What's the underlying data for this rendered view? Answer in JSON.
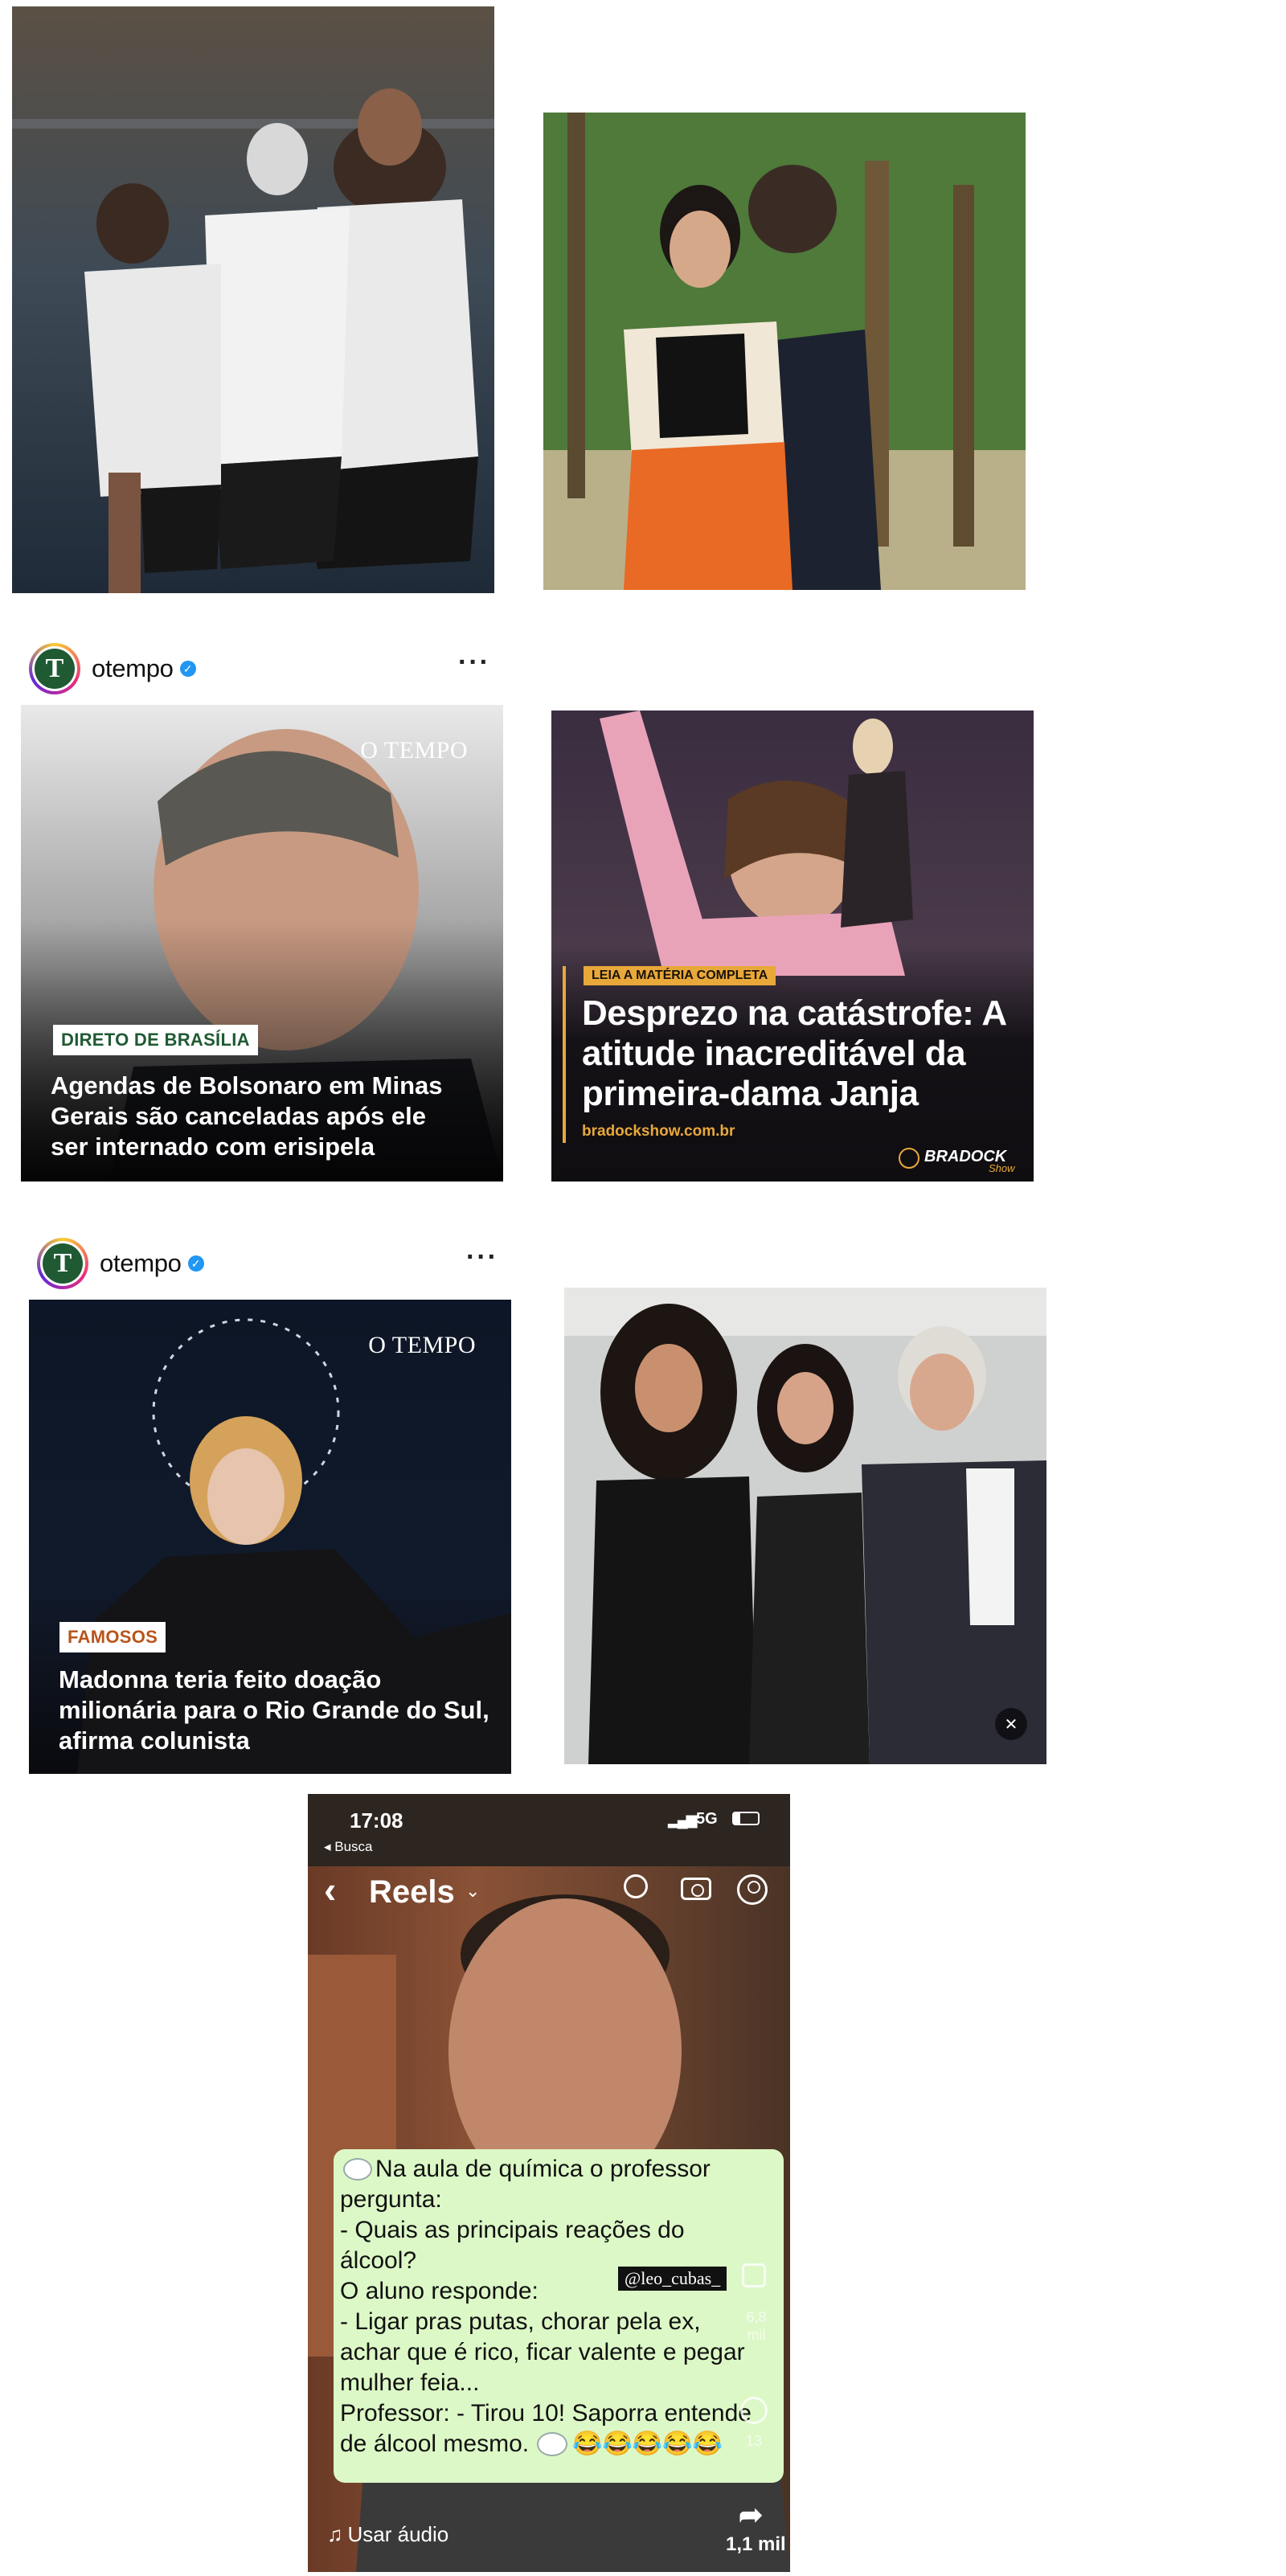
{
  "posts": [
    {
      "handle": "otempo",
      "more": "···",
      "card": {
        "brand": "O TEMPO",
        "tag": "DIRETO DE BRASÍLIA",
        "headline": "Agendas de Bolsonaro em Minas Gerais são canceladas após ele ser internado com erisipela"
      },
      "ad": {
        "kicker": "LEIA A MATÉRIA COMPLETA",
        "headline": "Desprezo na catástrofe: A atitude inacreditável da primeira-dama Janja",
        "url": "bradockshow.com.br",
        "logo": "BRADOCK",
        "logo_sub": "Show"
      }
    },
    {
      "handle": "otempo",
      "more": "···",
      "card": {
        "brand": "O TEMPO",
        "tag": "FAMOSOS",
        "headline": "Madonna teria feito doação milionária para o Rio Grande do Sul, afirma colunista"
      }
    }
  ],
  "reel": {
    "time": "17:08",
    "back_app": "◂ Busca",
    "network": "5G",
    "title": "Reels",
    "message_lines": [
      "Na aula de química o professor",
      "pergunta:",
      "- Quais as principais reações do",
      "álcool?",
      "O aluno responde:",
      "- Ligar pras putas, chorar pela ex,",
      "achar que é rico, ficar valente e pegar",
      "mulher feia...",
      "Professor: - Tirou 10! Saporra entende",
      "de álcool mesmo."
    ],
    "emojis": "😂😂😂😂😂",
    "username_tag": "@leo_cubas_",
    "likes": "6,8 mil",
    "comments": "13",
    "use_audio": "Usar áudio",
    "shares": "1,1 mil"
  },
  "colors": {
    "brand_green": "#1f5a33",
    "ad_orange": "#e8a83a",
    "chat_green": "#dcf8c6",
    "verified_blue": "#2196f3"
  }
}
